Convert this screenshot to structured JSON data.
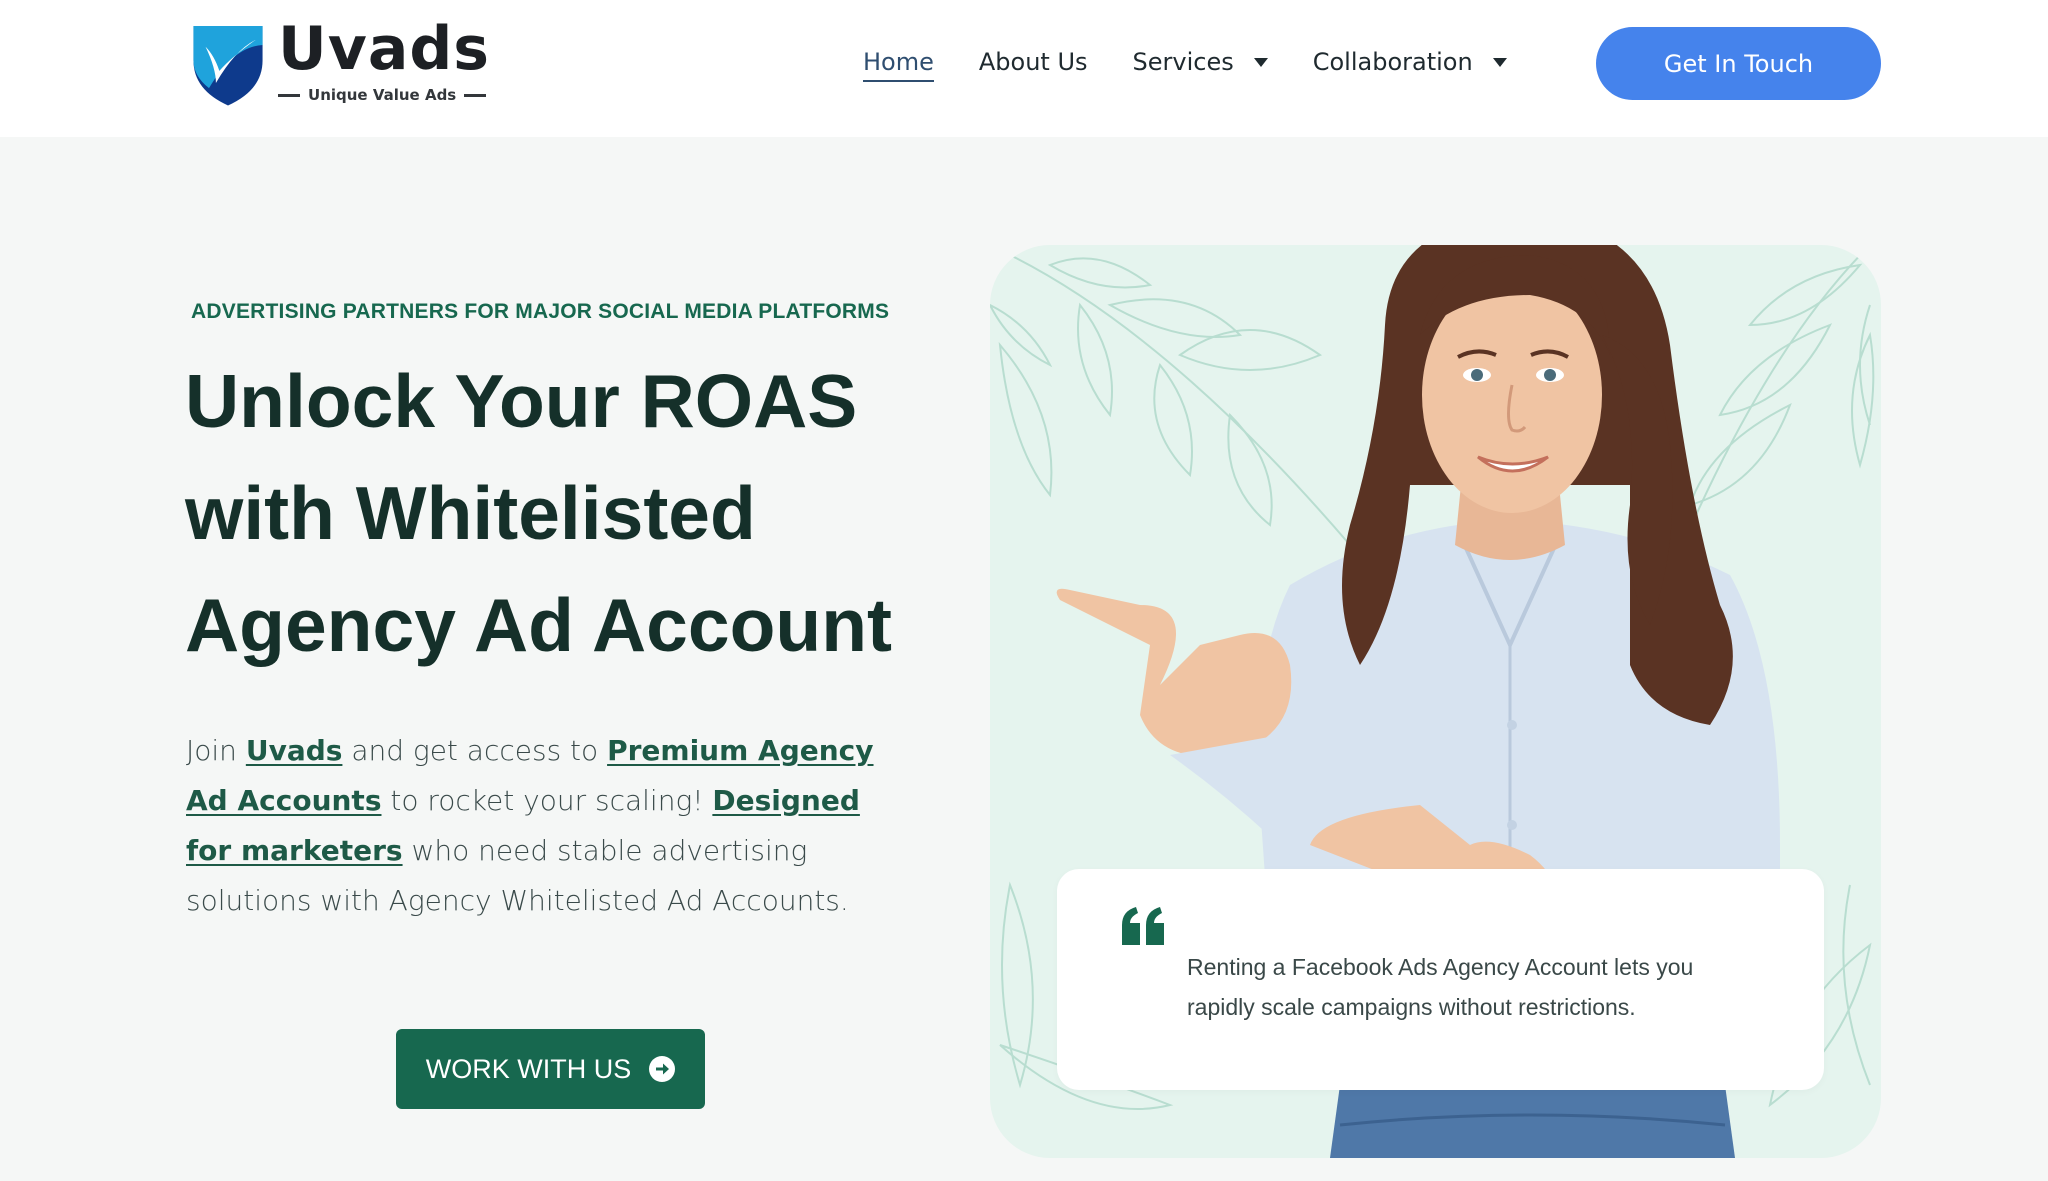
{
  "brand": {
    "name": "Uvads",
    "tagline": "Unique Value Ads",
    "colors": {
      "shield_dark": "#0e3a8c",
      "shield_light": "#1fa3dc",
      "primary_green": "#17684f",
      "accent_blue": "#4583ec"
    }
  },
  "nav": {
    "items": [
      {
        "label": "Home",
        "active": true
      },
      {
        "label": "About Us"
      },
      {
        "label": "Services",
        "icon": "caret-down-icon"
      },
      {
        "label": "Collaboration",
        "icon": "caret-down-icon"
      }
    ],
    "cta_label": "Get In Touch"
  },
  "hero": {
    "eyebrow": "ADVERTISING PARTNERS FOR MAJOR SOCIAL MEDIA PLATFORMS",
    "headline_lines": [
      "Unlock Your ROAS",
      "with Whitelisted",
      "Agency Ad Account"
    ],
    "intro": {
      "t1": "Join ",
      "link1": "Uvads",
      "t2": " and get access to ",
      "link2": "Premium Agency Ad Accounts",
      "t3": " to rocket your scaling! ",
      "link3": "Designed for marketers",
      "t4": " who need stable advertising solutions with Agency Whitelisted Ad Accounts."
    },
    "cta_label": "WORK WITH US",
    "cta_icon": "arrow-circle-right-icon"
  },
  "quote": {
    "icon": "quote-icon",
    "text": "Renting a Facebook Ads Agency Account lets you rapidly scale campaigns without restrictions."
  }
}
